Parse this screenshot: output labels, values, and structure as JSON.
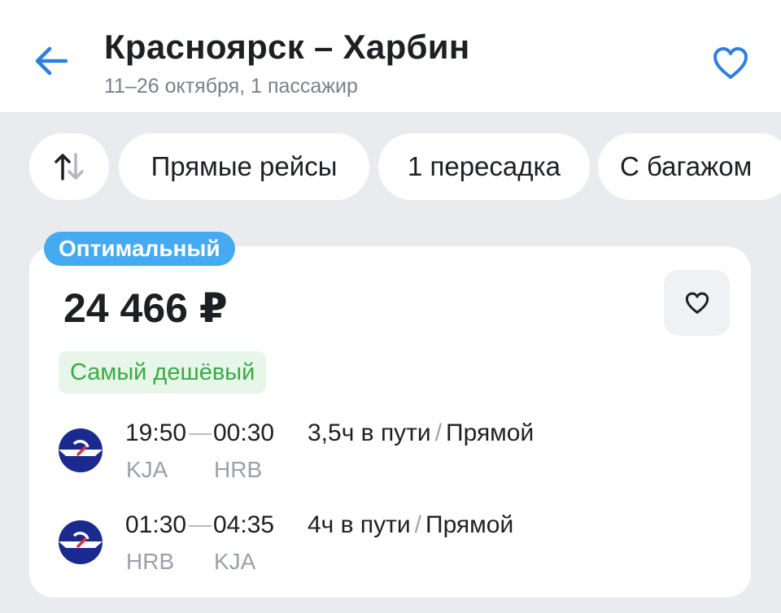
{
  "header": {
    "title": "Красноярск – Харбин",
    "subtitle": "11–26 октября, 1 пассажир"
  },
  "filters": {
    "chips": [
      "Прямые рейсы",
      "1 пересадка",
      "С багажом"
    ]
  },
  "card": {
    "badge": "Оптимальный",
    "price": "24 466 ₽",
    "tag": "Самый дешёвый",
    "segments": [
      {
        "departure_time": "19:50",
        "arrival_time": "00:30",
        "from": "KJA",
        "to": "HRB",
        "duration": "3,5ч в пути",
        "slash": "/",
        "type": "Прямой"
      },
      {
        "departure_time": "01:30",
        "arrival_time": "04:35",
        "from": "HRB",
        "to": "KJA",
        "duration": "4ч в пути",
        "slash": "/",
        "type": "Прямой"
      }
    ]
  },
  "colors": {
    "accent": "#2f7fe0",
    "badge": "#46aaf1",
    "cheap_text": "#3aaa45",
    "airline_logo": "#1b2a8e"
  },
  "icons": {
    "back": "arrow-left-icon",
    "favorite": "heart-outline-icon",
    "sort": "sort-arrows-icon",
    "airline": "aeroflot-logo-icon"
  }
}
